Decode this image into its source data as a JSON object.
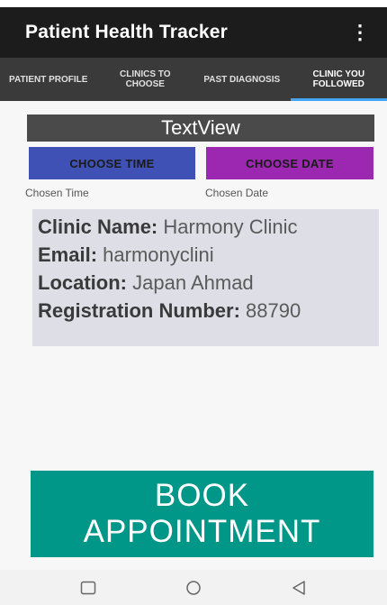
{
  "app": {
    "title": "Patient Health Tracker",
    "more_icon": "⋮"
  },
  "tabs": [
    {
      "label": "PATIENT PROFILE",
      "active": false
    },
    {
      "label": "CLINICS TO CHOOSE",
      "active": false
    },
    {
      "label": "PAST DIAGNOSIS",
      "active": false
    },
    {
      "label": "CLINIC YOU FOLLOWED",
      "active": true
    }
  ],
  "textview": {
    "text": "TextView"
  },
  "buttons": {
    "choose_time": "CHOOSE TIME",
    "choose_date": "CHOOSE DATE"
  },
  "chosen": {
    "time": "Chosen Time",
    "date": "Chosen Date"
  },
  "clinic": {
    "name_label": "Clinic Name:",
    "name": "Harmony Clinic",
    "email_label": "Email:",
    "email": "harmonyclini",
    "location_label": "Location:",
    "location": "Japan Ahmad",
    "reg_label": "Registration Number:",
    "reg": "88790"
  },
  "book_button": {
    "line1": "BOOK",
    "line2": "APPOINTMENT"
  },
  "colors": {
    "choose_time_bg": "#3f51b5",
    "choose_date_bg": "#9c27b0",
    "book_bg": "#009688",
    "active_tab_indicator": "#42a5f5"
  },
  "nav_icons": [
    "recent-apps-icon",
    "home-icon",
    "back-icon"
  ]
}
